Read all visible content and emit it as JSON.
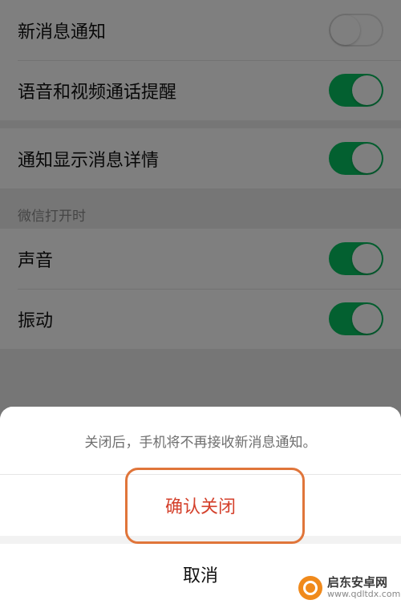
{
  "settings": {
    "group1": [
      {
        "label": "新消息通知",
        "toggle": "off"
      },
      {
        "label": "语音和视频通话提醒",
        "toggle": "on"
      }
    ],
    "group2": [
      {
        "label": "通知显示消息详情",
        "toggle": "on"
      }
    ],
    "section_header": "微信打开时",
    "group3": [
      {
        "label": "声音",
        "toggle": "on"
      },
      {
        "label": "振动",
        "toggle": "on"
      }
    ]
  },
  "sheet": {
    "message": "关闭后，手机将不再接收新消息通知。",
    "confirm_label": "确认关闭",
    "cancel_label": "取消"
  },
  "watermark": {
    "title": "启东安卓网",
    "url": "www.qdltdx.com"
  },
  "colors": {
    "toggle_on": "#07c160",
    "confirm_text": "#d4412c",
    "highlight_outline": "#e0753a",
    "page_background": "#ededed"
  }
}
